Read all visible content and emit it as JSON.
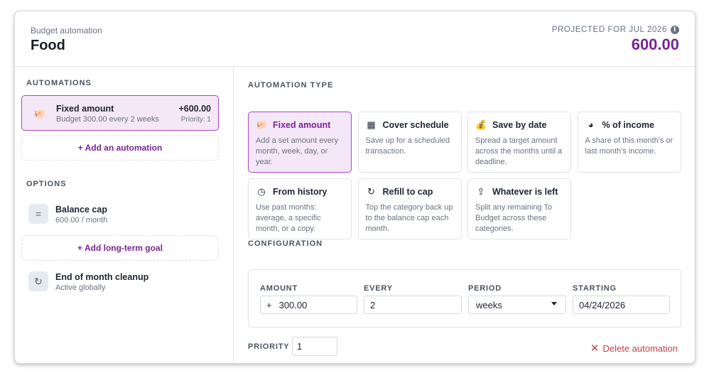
{
  "header": {
    "subtitle": "Budget automation",
    "title": "Food",
    "projected_label": "PROJECTED FOR JUL 2026",
    "projected_value": "600.00",
    "info_icon": "info-icon"
  },
  "automations": {
    "section_label": "AUTOMATIONS",
    "items": [
      {
        "icon": "piggy-bank-icon",
        "name": "Fixed amount",
        "desc": "Budget 300.00 every 2 weeks",
        "amount": "+600.00",
        "priority": "Priority: 1"
      }
    ],
    "add_label": "+ Add an automation"
  },
  "options": {
    "section_label": "OPTIONS",
    "balance_cap": {
      "icon": "equals-icon",
      "name": "Balance cap",
      "desc": "600.00 / month"
    },
    "add_goal_label": "+ Add long-term goal",
    "cleanup": {
      "icon": "refresh-icon",
      "name": "End of month cleanup",
      "desc": "Active globally"
    }
  },
  "automation_type": {
    "section_label": "AUTOMATION TYPE",
    "cards": [
      {
        "icon": "piggy-bank-icon",
        "glyph": "🐖",
        "name": "Fixed amount",
        "desc": "Add a set amount every month, week, day, or year.",
        "selected": true
      },
      {
        "icon": "calendar-icon",
        "glyph": "▦",
        "name": "Cover schedule",
        "desc": "Save up for a scheduled transaction.",
        "selected": false
      },
      {
        "icon": "money-bag-icon",
        "glyph": "💰",
        "name": "Save by date",
        "desc": "Spread a target amount across the months until a deadline.",
        "selected": false
      },
      {
        "icon": "pie-chart-icon",
        "glyph": "◕",
        "name": "% of income",
        "desc": "A share of this month's or last month's income.",
        "selected": false
      },
      {
        "icon": "clock-icon",
        "glyph": "◷",
        "name": "From history",
        "desc": "Use past months: average, a specific month, or a copy.",
        "selected": false
      },
      {
        "icon": "refill-icon",
        "glyph": "↻",
        "name": "Refill to cap",
        "desc": "Top the category back up to the balance cap each month.",
        "selected": false
      },
      {
        "icon": "upload-icon",
        "glyph": "⇪",
        "name": "Whatever is left",
        "desc": "Split any remaining To Budget across these categories.",
        "selected": false
      }
    ]
  },
  "configuration": {
    "section_label": "CONFIGURATION",
    "amount_label": "AMOUNT",
    "amount_sign": "+",
    "amount_value": "300.00",
    "every_label": "EVERY",
    "every_value": "2",
    "period_label": "PERIOD",
    "period_value": "weeks",
    "starting_label": "STARTING",
    "starting_value": "04/24/2026"
  },
  "footer": {
    "priority_label": "PRIORITY",
    "priority_value": "1",
    "delete_label": "Delete automation"
  },
  "colors": {
    "accent": "#7a2493",
    "selected_bg": "#f4e7f8",
    "danger": "#c2404e"
  }
}
